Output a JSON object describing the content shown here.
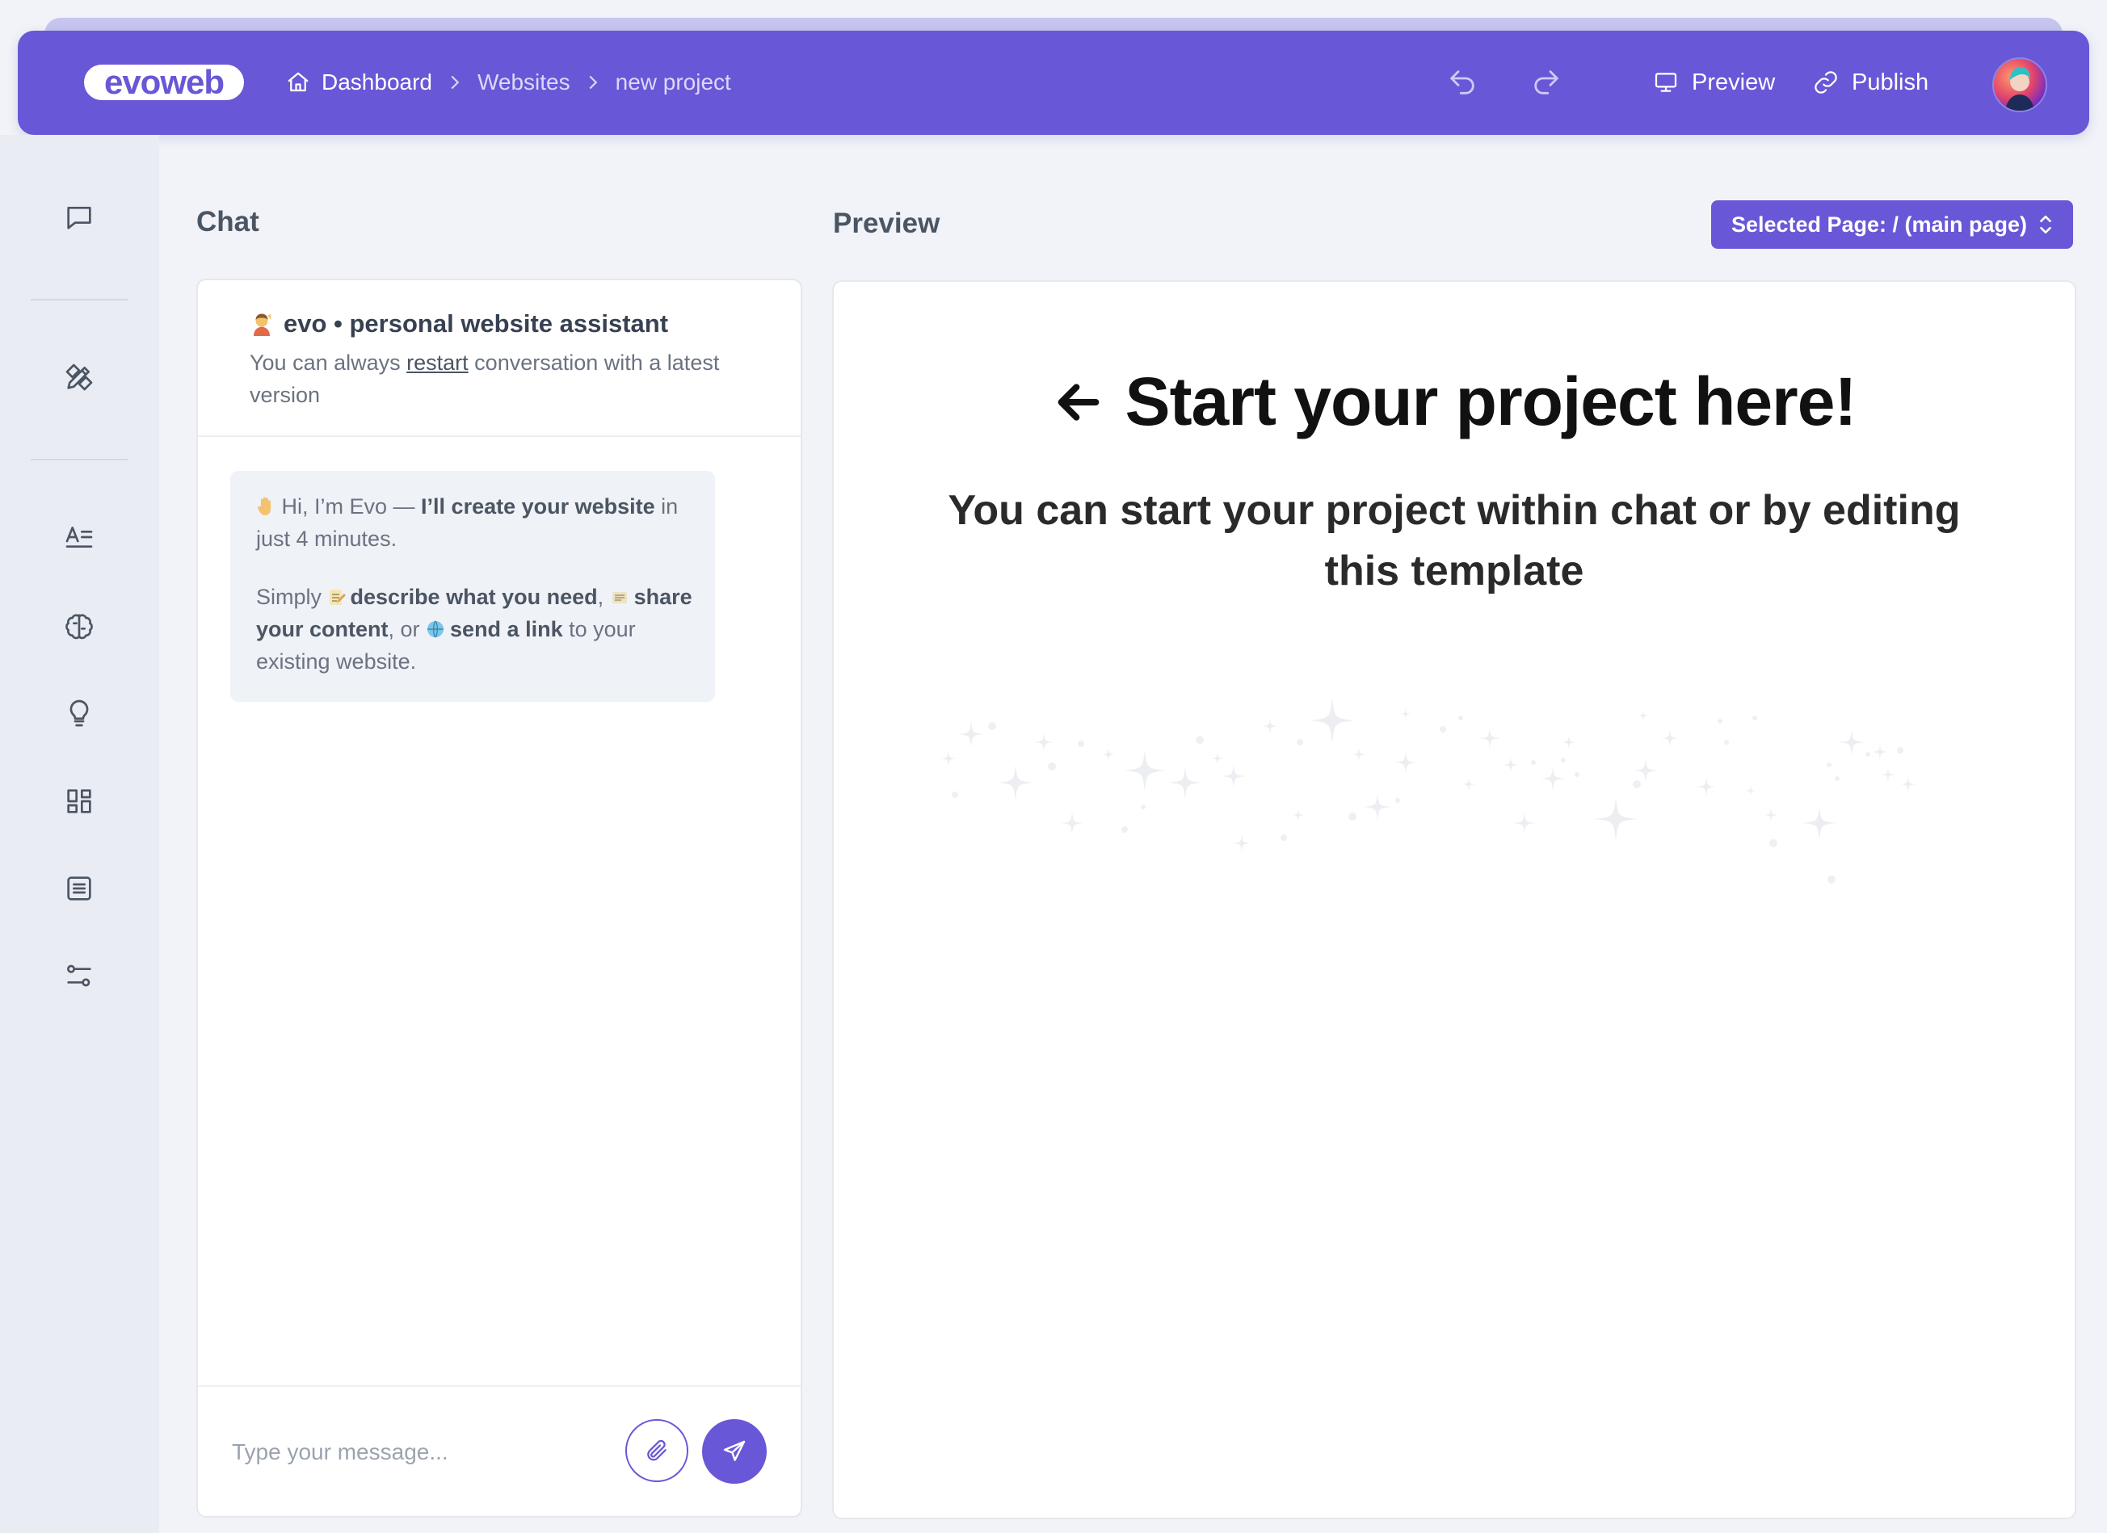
{
  "header": {
    "logo": "evoweb",
    "breadcrumb": [
      "Dashboard",
      "Websites",
      "new project"
    ],
    "preview_label": "Preview",
    "publish_label": "Publish"
  },
  "rail": {
    "icons": [
      "chat-icon",
      "design-tools-icon",
      "typography-icon",
      "brain-icon",
      "lightbulb-icon",
      "layout-grid-icon",
      "content-list-icon",
      "settings-sliders-icon"
    ]
  },
  "chat": {
    "section_title": "Chat",
    "header_title": "evo • personal website assistant",
    "header_sub_prefix": "You can always ",
    "header_sub_link": "restart",
    "header_sub_suffix": " conversation with a latest version",
    "message": {
      "greeting_plain": "Hi, I’m Evo — ",
      "greeting_bold": "I’ll create your website",
      "greeting_end": " in just 4 minutes.",
      "simply": "Simply ",
      "describe": "describe what you need",
      "comma": ",",
      "share": "share your content",
      "or": ", or ",
      "link": "send a link",
      "end": " to your existing website."
    },
    "input_placeholder": "Type your message..."
  },
  "preview": {
    "section_title": "Preview",
    "page_select_label": "Selected Page: / (main page)",
    "headline": "Start your project here!",
    "subheadline": "You can start your project within chat or by editing this template"
  },
  "colors": {
    "brand": "#6857d6",
    "background": "#f1f3f8",
    "card": "#ffffff"
  }
}
